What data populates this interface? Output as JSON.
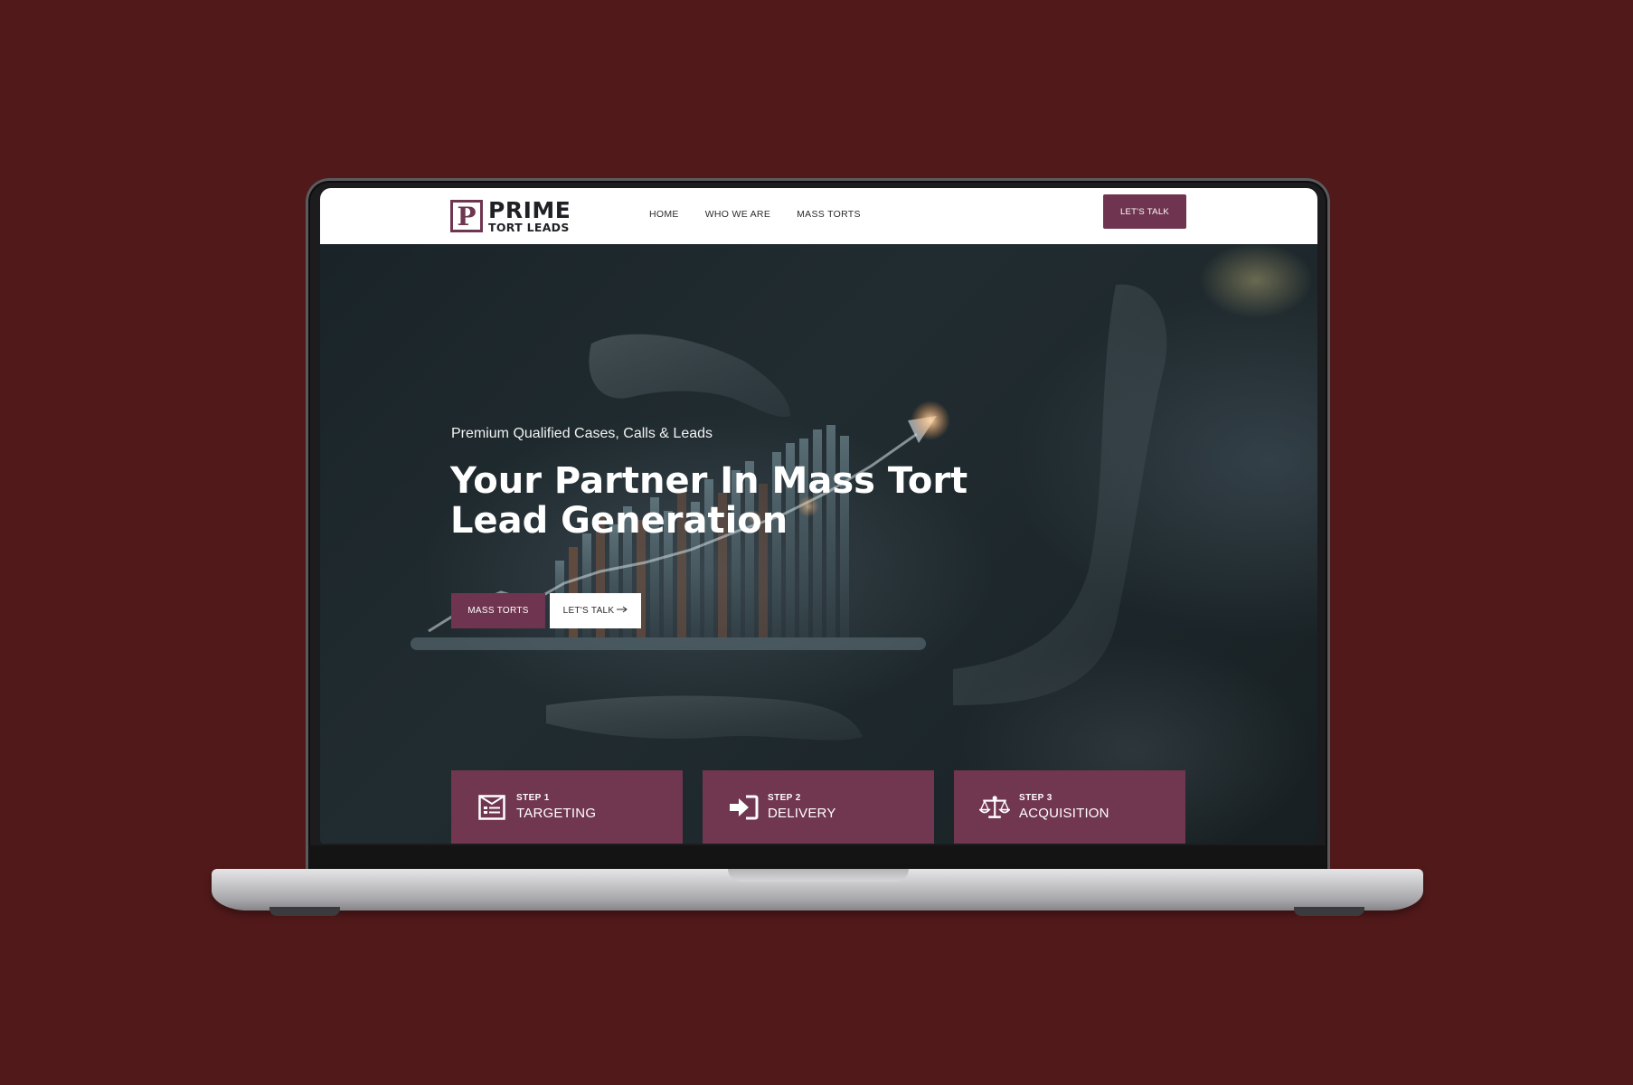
{
  "header": {
    "logo_title": "PRIME",
    "logo_subtitle": "TORT LEADS",
    "nav": [
      "HOME",
      "WHO WE ARE",
      "MASS TORTS"
    ],
    "cta_label": "LET'S TALK"
  },
  "hero": {
    "eyebrow": "Premium Qualified Cases, Calls & Leads",
    "title": "Your Partner In Mass Tort Lead Generation",
    "primary_button": "MASS TORTS",
    "secondary_button": "LET'S TALK",
    "secondary_icon": "arrow-right-icon"
  },
  "steps": [
    {
      "label": "STEP 1",
      "title": "TARGETING",
      "icon": "newspaper-list-icon"
    },
    {
      "label": "STEP 2",
      "title": "DELIVERY",
      "icon": "sign-in-arrow-icon"
    },
    {
      "label": "STEP 3",
      "title": "ACQUISITION",
      "icon": "balance-scale-icon"
    }
  ],
  "colors": {
    "background": "#51191a",
    "brand": "#6f3550",
    "hero_bg": "#1d272b"
  }
}
